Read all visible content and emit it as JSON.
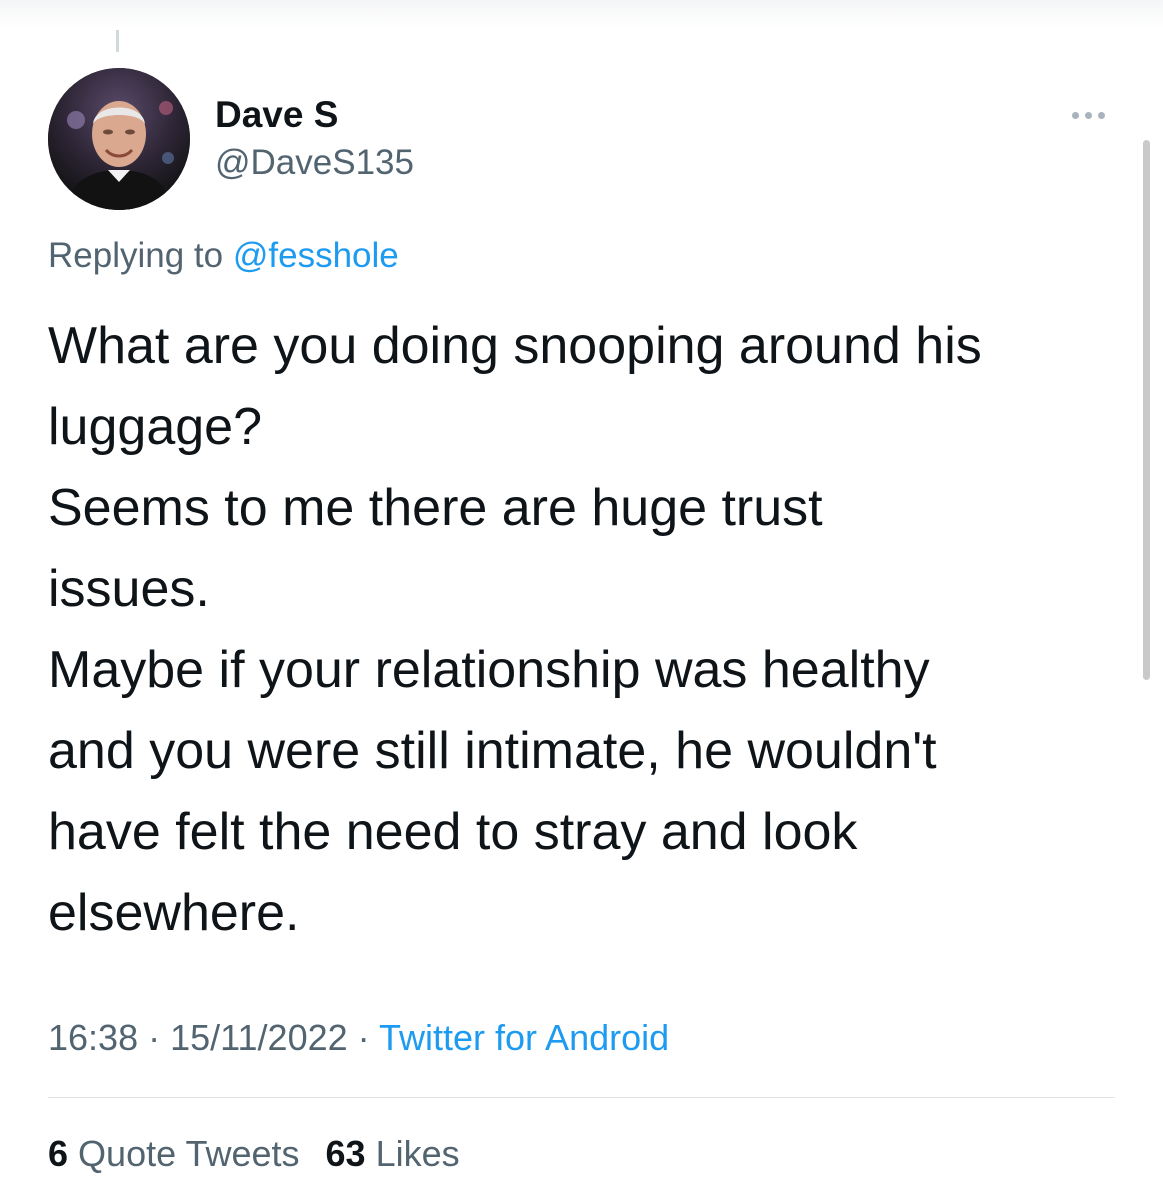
{
  "author": {
    "display_name": "Dave S",
    "handle": "@DaveS135",
    "avatar_icon": "profile-photo"
  },
  "reply": {
    "prefix": "Replying to",
    "mention": "@fesshole"
  },
  "tweet": {
    "lines": [
      "What are you doing snooping around his",
      "luggage?",
      "Seems to me there are huge trust",
      "issues.",
      "Maybe if your relationship was healthy",
      "and you were still intimate, he wouldn't",
      "have felt the need to stray and look",
      "elsewhere."
    ]
  },
  "meta": {
    "time": "16:38",
    "separator": "·",
    "date": "15/11/2022",
    "source": "Twitter for Android"
  },
  "stats": {
    "quote_tweets_count": "6",
    "quote_tweets_label": "Quote Tweets",
    "likes_count": "63",
    "likes_label": "Likes"
  },
  "colors": {
    "accent": "#1d9bf0",
    "secondary_text": "#536471",
    "primary_text": "#0f1419",
    "divider": "#dfe4e8"
  },
  "icons": {
    "more": "more-options-icon"
  }
}
